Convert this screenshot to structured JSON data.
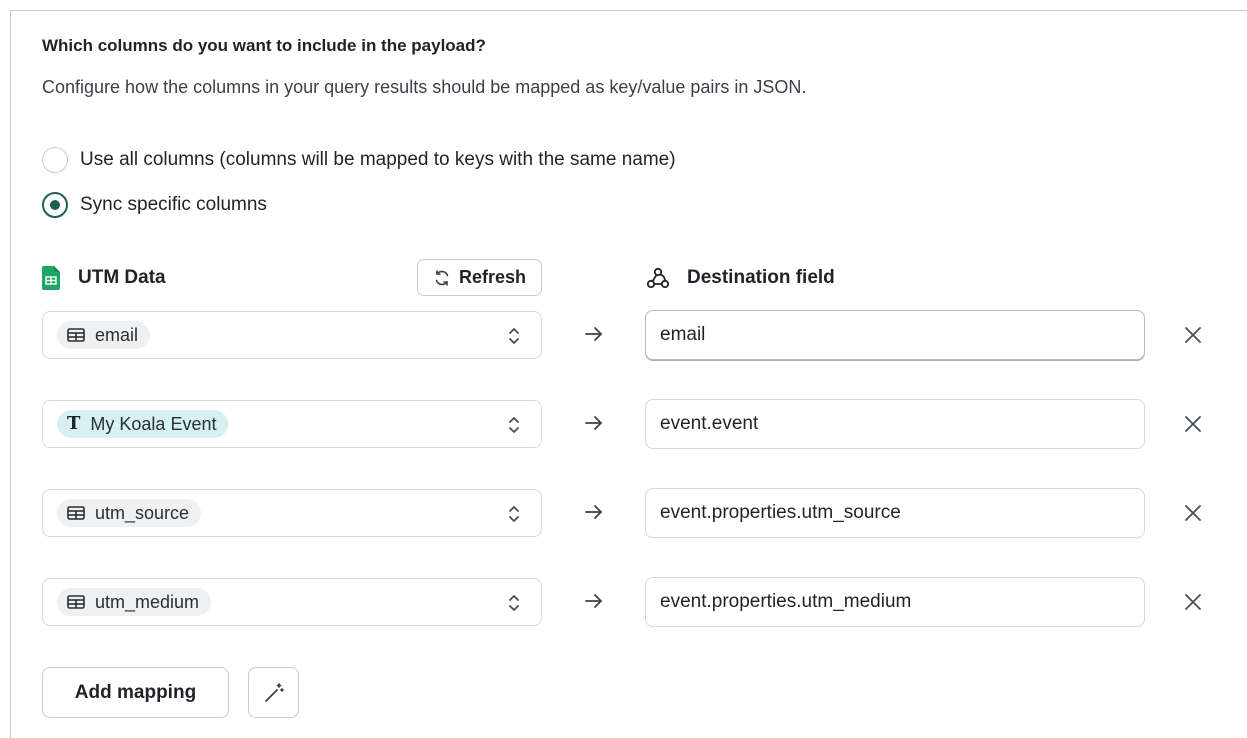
{
  "section": {
    "question": "Which columns do you want to include in the payload?",
    "description": "Configure how the columns in your query results should be mapped as key/value pairs in JSON."
  },
  "options": [
    {
      "label": "Use all columns (columns will be mapped to keys with the same name)",
      "checked": false
    },
    {
      "label": "Sync specific columns",
      "checked": true
    }
  ],
  "source": {
    "title": "UTM Data",
    "icon": "google-sheets-icon",
    "refresh_label": "Refresh"
  },
  "destination": {
    "title": "Destination field",
    "icon": "webhook-icon"
  },
  "mappings": [
    {
      "source_column": "email",
      "source_type": "column-icon",
      "destination": "email"
    },
    {
      "source_column": "My Koala Event",
      "source_type": "text-icon",
      "destination": "event.event"
    },
    {
      "source_column": "utm_source",
      "source_type": "column-icon",
      "destination": "event.properties.utm_source"
    },
    {
      "source_column": "utm_medium",
      "source_type": "column-icon",
      "destination": "event.properties.utm_medium"
    }
  ],
  "actions": {
    "add_mapping_label": "Add mapping",
    "magic_icon": "magic-wand-icon"
  },
  "colors": {
    "accent": "#1f5f5a",
    "sheets_green": "#1fa463",
    "text_chip_bg": "#d6f1ef",
    "chip_bg": "#eef0f2",
    "border": "#d5d8dc"
  }
}
